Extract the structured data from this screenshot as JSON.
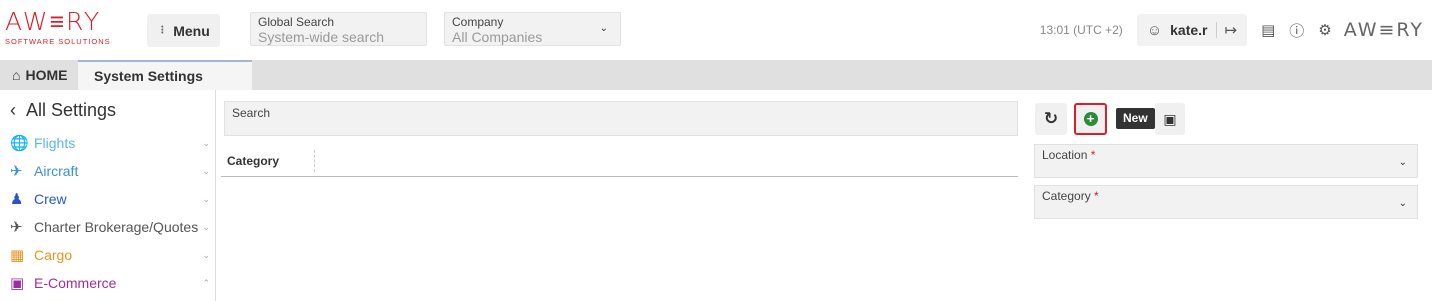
{
  "header": {
    "logo_word": "AW≡RY",
    "logo_sub": "SOFTWARE SOLUTIONS",
    "menu_label": "Menu",
    "global_search": {
      "label": "Global Search",
      "placeholder": "System-wide search"
    },
    "company": {
      "label": "Company",
      "value": "All Companies"
    },
    "time": "13:01 (UTC +2)",
    "username": "kate.r",
    "right_logo": "AW≡RY"
  },
  "tabs": [
    {
      "label": "HOME"
    },
    {
      "label": "System Settings"
    }
  ],
  "sidebar": {
    "back_label": "All Settings",
    "items": [
      {
        "label": "Flights",
        "color": "#5bb7e6",
        "icon": "globe-icon"
      },
      {
        "label": "Aircraft",
        "color": "#3a8fd6",
        "icon": "airplane-icon"
      },
      {
        "label": "Crew",
        "color": "#2a55c9",
        "icon": "crew-icon"
      },
      {
        "label": "Charter Brokerage/Quotes",
        "color": "#555555",
        "icon": "plane-takeoff-icon"
      },
      {
        "label": "Cargo",
        "color": "#e8951f",
        "icon": "warehouse-icon"
      },
      {
        "label": "E-Commerce",
        "color": "#9b2f9e",
        "icon": "money-icon"
      }
    ]
  },
  "main": {
    "search_label": "Search",
    "columns": [
      "Category"
    ]
  },
  "panel": {
    "tooltip": "New",
    "location_label": "Location",
    "category_label": "Category",
    "required_mark": "*"
  }
}
